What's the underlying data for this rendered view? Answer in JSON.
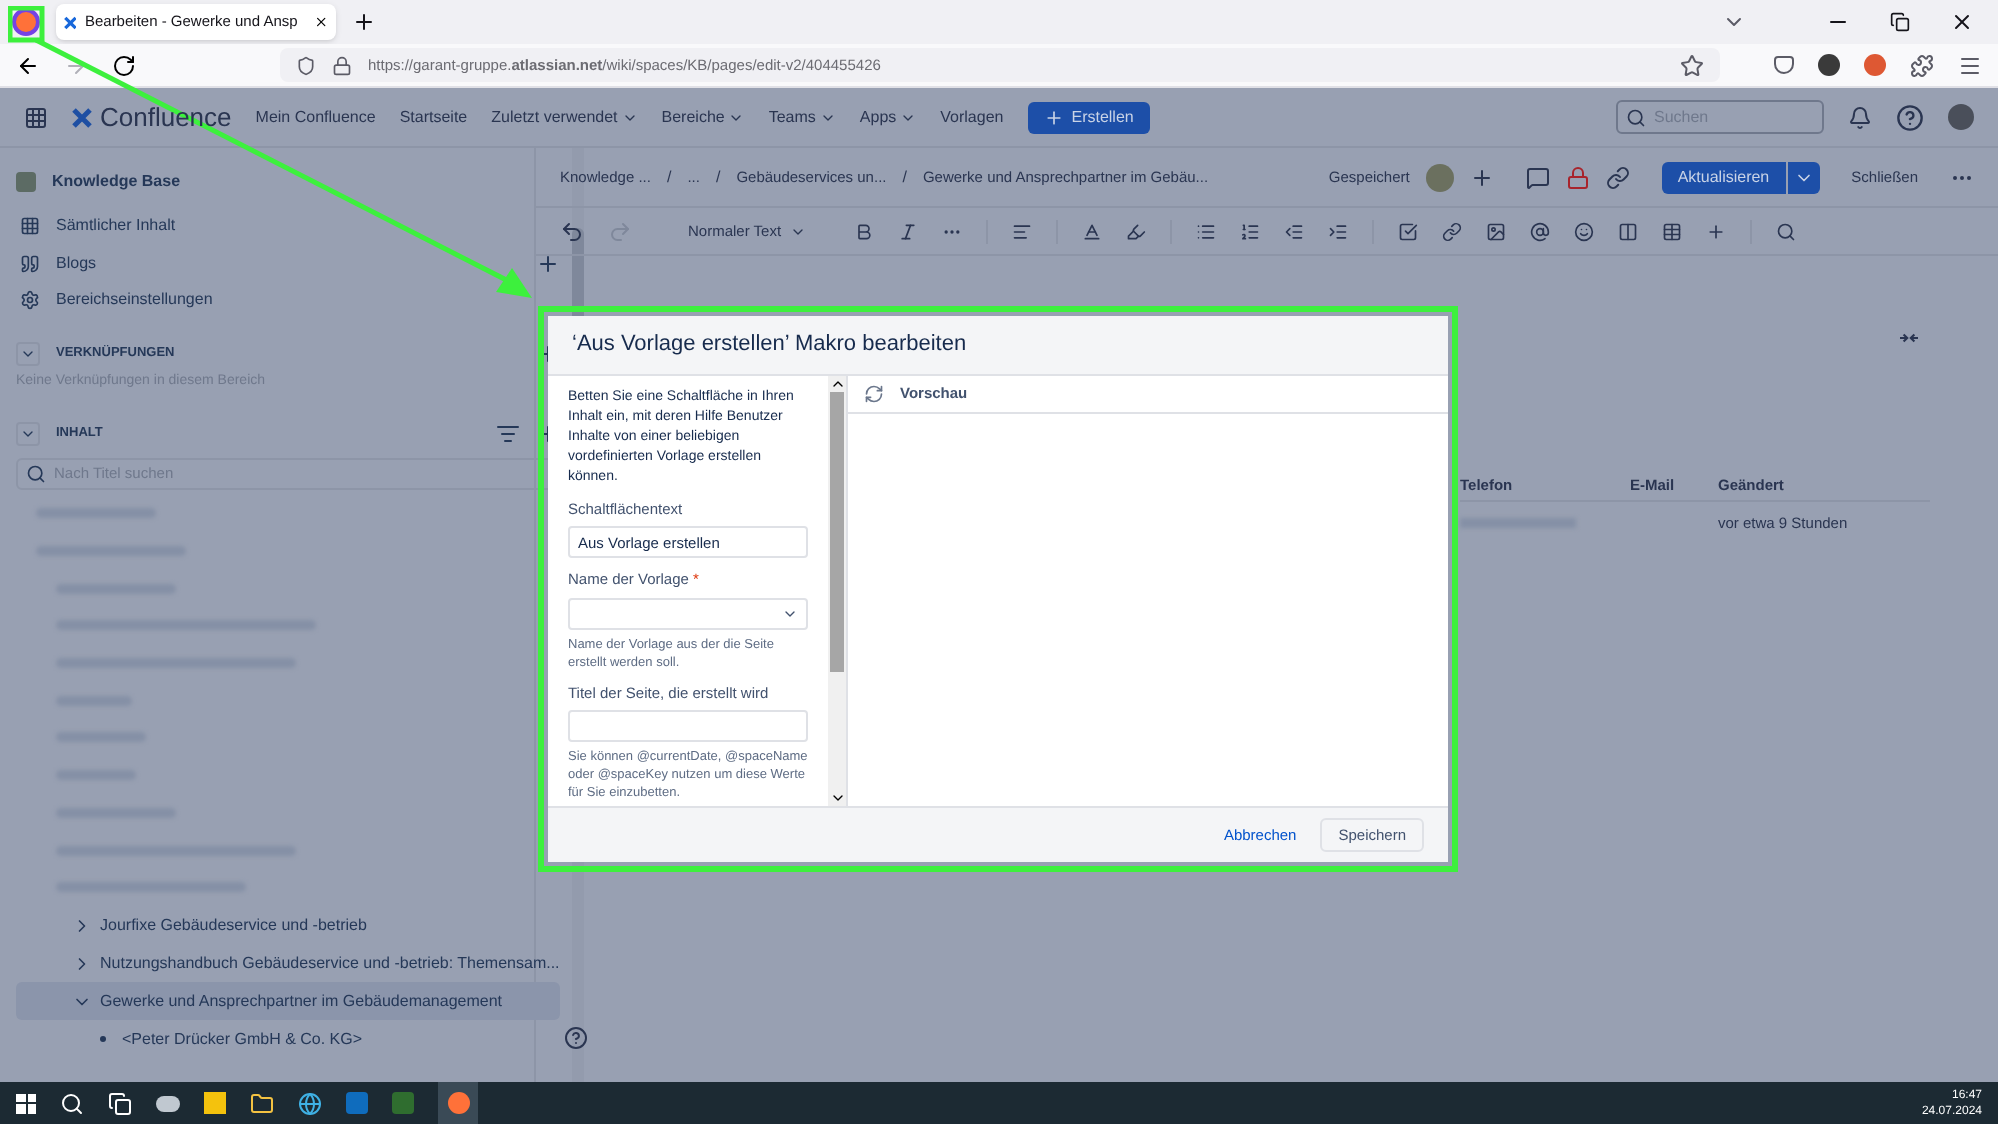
{
  "browser": {
    "tab_title": "Bearbeiten - Gewerke und Ansp",
    "url": "https://garant-gruppe.**atlassian.net**/wiki/spaces/KB/pages/edit-v2/404455426"
  },
  "nav": {
    "logo": "Confluence",
    "items": [
      {
        "label": "Mein Confluence",
        "dropdown": false
      },
      {
        "label": "Startseite",
        "dropdown": false
      },
      {
        "label": "Zuletzt verwendet",
        "dropdown": true
      },
      {
        "label": "Bereiche",
        "dropdown": true
      },
      {
        "label": "Teams",
        "dropdown": true
      },
      {
        "label": "Apps",
        "dropdown": true
      },
      {
        "label": "Vorlagen",
        "dropdown": false
      }
    ],
    "create_button": "Erstellen",
    "search_placeholder": "Suchen"
  },
  "sidebar": {
    "space": "Knowledge Base",
    "items": [
      {
        "kind": "grid",
        "label": "Sämtlicher Inhalt"
      },
      {
        "kind": "quote",
        "label": "Blogs"
      },
      {
        "kind": "gear",
        "label": "Bereichseinstellungen"
      }
    ],
    "shortcuts": {
      "title": "VERKNÜPFUNGEN",
      "empty_text": "Keine Verknüpfungen in diesem Bereich"
    },
    "content": {
      "title": "INHALT",
      "search_placeholder": "Nach Titel suchen",
      "tree": [
        {
          "label": "Jourfixe Gebäudeservice und -betrieb",
          "expanded": false,
          "selected": false
        },
        {
          "label": "Nutzungshandbuch Gebäudeservice und -betrieb: Themensam...",
          "expanded": false,
          "selected": false
        },
        {
          "label": "Gewerke und Ansprechpartner im Gebäudemanagement",
          "expanded": true,
          "selected": true,
          "children": [
            {
              "label": "<Peter Drücker GmbH & Co. KG>",
              "selected": false
            }
          ]
        }
      ]
    }
  },
  "editor": {
    "breadcrumb_separator": "/",
    "breadcrumbs": [
      "Knowledge ...",
      "...",
      "Gebäudeservices un...",
      "Gewerke und Ansprechpartner im Gebäu..."
    ],
    "saved": "Gespeichert",
    "update_button": "Aktualisieren",
    "close_button": "Schließen",
    "text_style": "Normaler Text",
    "table": {
      "columns": [
        "Telefon",
        "E-Mail",
        "Geändert"
      ],
      "rows": [
        {
          "changed": "vor etwa 9 Stunden"
        }
      ]
    }
  },
  "dialog": {
    "title": "‘Aus Vorlage erstellen’ Makro bearbeiten",
    "description": "Betten Sie eine Schaltfläche in Ihren Inhalt ein, mit deren Hilfe Benutzer Inhalte von einer beliebigen vordefinierten Vorlage erstellen können.",
    "fields": [
      {
        "kind": "text",
        "label": "Schaltflächentext",
        "value": "Aus Vorlage erstellen"
      },
      {
        "kind": "select",
        "label": "Name der Vorlage",
        "required_mark": "*",
        "help": "Name der Vorlage aus der die Seite erstellt werden soll."
      },
      {
        "kind": "text",
        "label": "Titel der Seite, die erstellt wird",
        "help": "Sie können @currentDate, @spaceName oder @spaceKey nutzen um diese Werte für Sie einzubetten."
      }
    ],
    "preview": "Vorschau",
    "cancel_button": "Abbrechen",
    "save_button": "Speichern"
  },
  "taskbar": {
    "time": "16:47",
    "date": "24.07.2024"
  }
}
